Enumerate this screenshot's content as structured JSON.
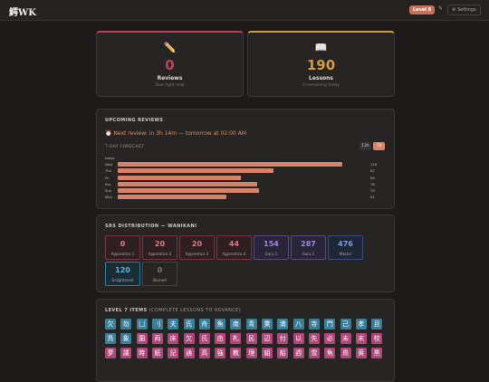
{
  "header": {
    "logo": "鰐WK",
    "level_badge": "Level 8",
    "edit_icon_glyph": "✎",
    "settings_label": "⚙ Settings"
  },
  "stats": {
    "reviews": {
      "icon": "✏️",
      "count": "0",
      "label": "Reviews",
      "sub": "Due right now",
      "color": "#c0405a"
    },
    "lessons": {
      "icon": "📖",
      "count": "190",
      "label": "Lessons",
      "sub": "0 remaining today",
      "color": "#d99a3a"
    }
  },
  "upcoming": {
    "title": "UPCOMING REVIEWS",
    "next_review": "⏰ Next review: in 3h 14m — tomorrow at 02:00 AM",
    "forecast_label": "7-DAY FORECAST",
    "toggles": [
      "12h",
      "7d"
    ],
    "active_toggle": "7d"
  },
  "chart_data": {
    "type": "bar",
    "orientation": "horizontal",
    "categories": [
      "today",
      "Wed",
      "Thu",
      "Fri",
      "Sat",
      "Sun",
      "Mon"
    ],
    "values": [
      0,
      126,
      87,
      69,
      78,
      79,
      61
    ],
    "value_labels": [
      "",
      "126",
      "87",
      "69",
      "78",
      "79",
      "61"
    ],
    "xlim": [
      0,
      140
    ],
    "bar_color": "#d9826a"
  },
  "srs": {
    "title": "SRS DISTRIBUTION — WANIKANI",
    "stages": [
      {
        "count": "0",
        "label": "Apprentice 1",
        "border": "#7a3444",
        "bg": "#2e1f22",
        "text": "#e07a8a"
      },
      {
        "count": "20",
        "label": "Apprentice 2",
        "border": "#7a3444",
        "bg": "#2e1f22",
        "text": "#e07a8a"
      },
      {
        "count": "20",
        "label": "Apprentice 3",
        "border": "#7a3444",
        "bg": "#2e1f22",
        "text": "#e07a8a"
      },
      {
        "count": "44",
        "label": "Apprentice 4",
        "border": "#7a3444",
        "bg": "#2e1f22",
        "text": "#e07a8a"
      },
      {
        "count": "154",
        "label": "Guru 1",
        "border": "#5a4a7a",
        "bg": "#28243a",
        "text": "#a38ad9"
      },
      {
        "count": "287",
        "label": "Guru 2",
        "border": "#5a4a7a",
        "bg": "#28243a",
        "text": "#a38ad9"
      },
      {
        "count": "476",
        "label": "Master",
        "border": "#3a507a",
        "bg": "#1f2636",
        "text": "#7a9ae0"
      },
      {
        "count": "120",
        "label": "Enlightened",
        "border": "#2a7a9a",
        "bg": "#1a2d36",
        "text": "#5ab4d9"
      },
      {
        "count": "0",
        "label": "Burned",
        "border": "#444",
        "bg": "#262524",
        "text": "#777"
      }
    ]
  },
  "items": {
    "title": "LEVEL 7 ITEMS",
    "subtitle": "(COMPLETE LESSONS TO ADVANCE)",
    "colors": {
      "radical": "#3a7f9a",
      "kanji": "#b0467a",
      "vocab": "#5a4e8f"
    },
    "rows": [
      [
        {
          "c": "欠",
          "t": "radical"
        },
        {
          "c": "勿",
          "t": "radical"
        },
        {
          "c": "凵",
          "t": "radical"
        },
        {
          "c": "刂",
          "t": "radical"
        },
        {
          "c": "夫",
          "t": "radical"
        },
        {
          "c": "氏",
          "t": "radical"
        },
        {
          "c": "舟",
          "t": "radical"
        },
        {
          "c": "魚",
          "t": "radical"
        },
        {
          "c": "南",
          "t": "radical"
        },
        {
          "c": "青",
          "t": "radical"
        },
        {
          "c": "業",
          "t": "radical"
        },
        {
          "c": "満",
          "t": "radical"
        },
        {
          "c": "八",
          "t": "radical"
        },
        {
          "c": "寺",
          "t": "radical"
        },
        {
          "c": "門",
          "t": "radical"
        },
        {
          "c": "己",
          "t": "radical"
        },
        {
          "c": "孝",
          "t": "radical"
        },
        {
          "c": "且",
          "t": "radical"
        }
      ],
      [
        {
          "c": "鳥",
          "t": "radical"
        },
        {
          "c": "象",
          "t": "radical"
        },
        {
          "c": "園",
          "t": "kanji"
        },
        {
          "c": "両",
          "t": "kanji"
        },
        {
          "c": "床",
          "t": "kanji"
        },
        {
          "c": "欠",
          "t": "kanji"
        },
        {
          "c": "氏",
          "t": "kanji"
        },
        {
          "c": "由",
          "t": "kanji"
        },
        {
          "c": "札",
          "t": "kanji"
        },
        {
          "c": "民",
          "t": "kanji"
        },
        {
          "c": "辺",
          "t": "kanji"
        },
        {
          "c": "付",
          "t": "kanji"
        },
        {
          "c": "以",
          "t": "kanji"
        },
        {
          "c": "失",
          "t": "kanji"
        },
        {
          "c": "必",
          "t": "kanji"
        },
        {
          "c": "未",
          "t": "kanji"
        },
        {
          "c": "末",
          "t": "kanji"
        },
        {
          "c": "校",
          "t": "kanji"
        }
      ],
      [
        {
          "c": "夢",
          "t": "kanji"
        },
        {
          "c": "議",
          "t": "kanji"
        },
        {
          "c": "時",
          "t": "kanji"
        },
        {
          "c": "紙",
          "t": "kanji"
        },
        {
          "c": "記",
          "t": "kanji"
        },
        {
          "c": "通",
          "t": "kanji"
        },
        {
          "c": "高",
          "t": "kanji"
        },
        {
          "c": "強",
          "t": "kanji"
        },
        {
          "c": "教",
          "t": "kanji"
        },
        {
          "c": "理",
          "t": "kanji"
        },
        {
          "c": "組",
          "t": "kanji"
        },
        {
          "c": "船",
          "t": "kanji"
        },
        {
          "c": "週",
          "t": "kanji"
        },
        {
          "c": "雪",
          "t": "kanji"
        },
        {
          "c": "魚",
          "t": "kanji"
        },
        {
          "c": "鳥",
          "t": "kanji"
        },
        {
          "c": "黄",
          "t": "kanji"
        },
        {
          "c": "黒",
          "t": "kanji"
        }
      ]
    ]
  }
}
